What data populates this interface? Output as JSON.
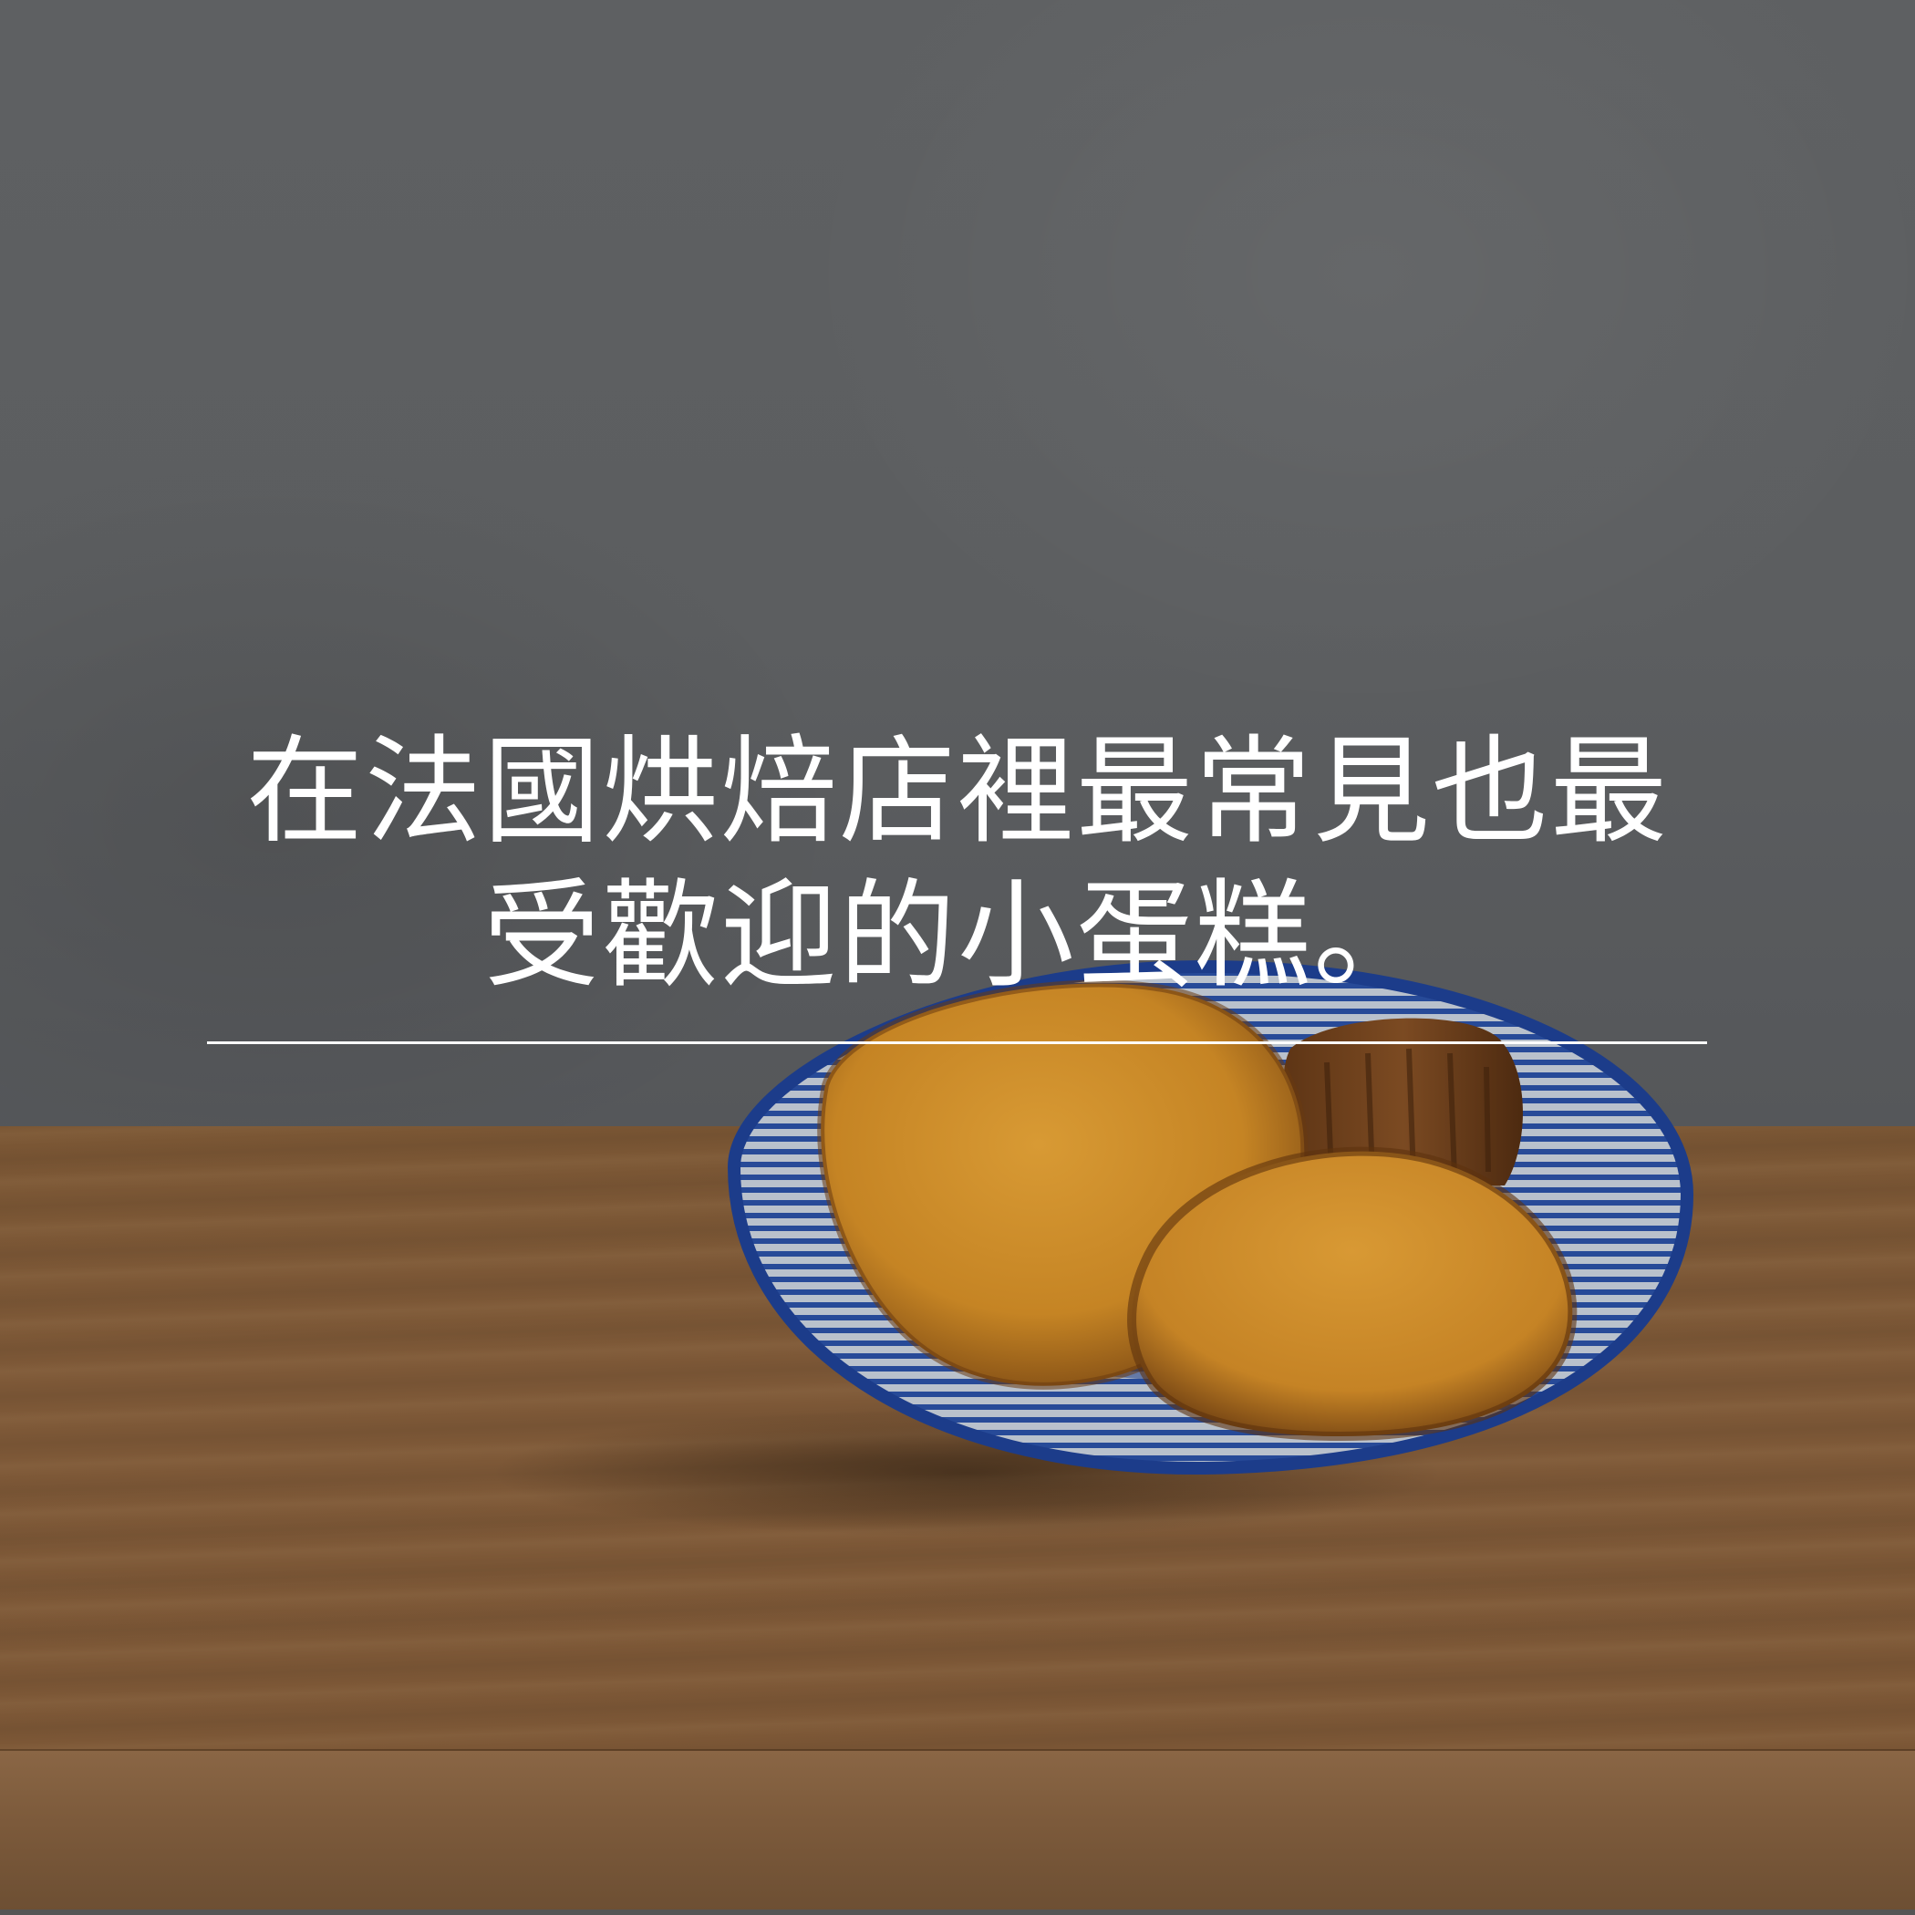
{
  "caption": {
    "line1": "在法國烘焙店裡最常見也最",
    "line2": "受歡迎的小蛋糕。"
  },
  "colors": {
    "text": "#ffffff",
    "wall": "#5d5f61",
    "table": "#7b5636",
    "bowl_glaze": "#1f3f8e",
    "cake": "#c98a25"
  }
}
